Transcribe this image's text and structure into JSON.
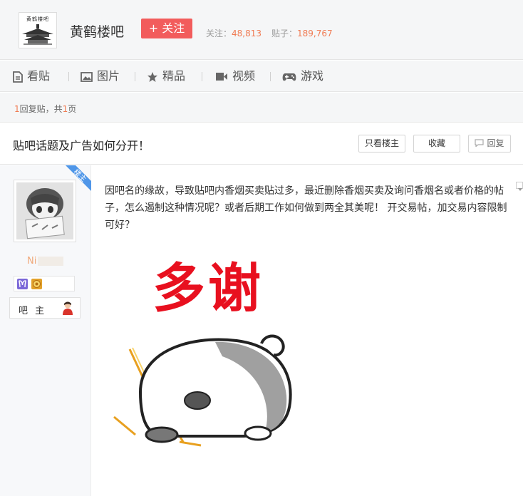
{
  "header": {
    "logo_text": "黄鹤楼吧",
    "bar_name": "黄鹤楼吧",
    "follow_button": "+ 关注",
    "follow_label": "关注：",
    "follow_count": "48,813",
    "posts_label": "贴子：",
    "posts_count": "189,767"
  },
  "nav": {
    "items": [
      {
        "label": "看贴",
        "icon": "document-icon"
      },
      {
        "label": "图片",
        "icon": "image-icon"
      },
      {
        "label": "精品",
        "icon": "star-icon"
      },
      {
        "label": "视频",
        "icon": "video-icon"
      },
      {
        "label": "游戏",
        "icon": "gamepad-icon"
      }
    ]
  },
  "pagebar": {
    "reply_count": "1",
    "reply_text": "回复贴，共",
    "page_count": "1",
    "page_unit": "页"
  },
  "post": {
    "title": "贴吧话题及广告如何分开！",
    "btn_only_author": "只看楼主",
    "btn_collect": "收藏",
    "btn_reply": "回复",
    "louzhu_tag": "楼主",
    "author_name_prefix": "Ni",
    "author_role": "吧 主",
    "body": "因吧名的缘故，导致贴吧内香烟买卖贴过多，最近删除香烟买卖及询问香烟名或者价格的帖子，怎么遏制这种情况呢？或者后期工作如何做到两全其美呢！ 开交易帖，加交易内容限制可好？",
    "sticker_text": "多谢"
  },
  "colors": {
    "follow_button": "#f25c5c",
    "stat_number": "#f07b53",
    "louzhu_ribbon": "#4f96e8",
    "sticker_red": "#e8101f",
    "username": "#f0a879"
  }
}
